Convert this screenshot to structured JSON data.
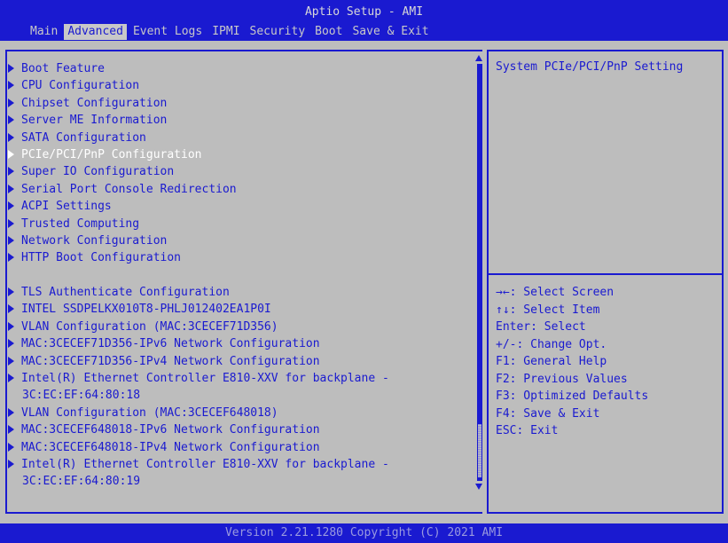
{
  "window": {
    "title": "Aptio Setup - AMI"
  },
  "tabs": [
    {
      "label": "Main",
      "active": false
    },
    {
      "label": "Advanced",
      "active": true
    },
    {
      "label": "Event Logs",
      "active": false
    },
    {
      "label": "IPMI",
      "active": false
    },
    {
      "label": "Security",
      "active": false
    },
    {
      "label": "Boot",
      "active": false
    },
    {
      "label": "Save & Exit",
      "active": false
    }
  ],
  "menu_items": [
    {
      "label": "Boot Feature"
    },
    {
      "label": "CPU Configuration"
    },
    {
      "label": "Chipset Configuration"
    },
    {
      "label": "Server ME Information"
    },
    {
      "label": "SATA Configuration"
    },
    {
      "label": "PCIe/PCI/PnP Configuration",
      "selected": true
    },
    {
      "label": "Super IO Configuration"
    },
    {
      "label": "Serial Port Console Redirection"
    },
    {
      "label": "ACPI Settings"
    },
    {
      "label": "Trusted Computing"
    },
    {
      "label": "Network Configuration"
    },
    {
      "label": "HTTP Boot Configuration"
    },
    {
      "label": "TLS Authenticate Configuration"
    },
    {
      "label": "INTEL SSDPELKX010T8-PHLJ012402EA1P0I"
    },
    {
      "label": "VLAN Configuration (MAC:3CECEF71D356)"
    },
    {
      "label": "MAC:3CECEF71D356-IPv6 Network Configuration"
    },
    {
      "label": "MAC:3CECEF71D356-IPv4 Network Configuration"
    },
    {
      "label": "Intel(R) Ethernet Controller E810-XXV for backplane -",
      "continuation": "3C:EC:EF:64:80:18"
    },
    {
      "label": "VLAN Configuration (MAC:3CECEF648018)"
    },
    {
      "label": "MAC:3CECEF648018-IPv6 Network Configuration"
    },
    {
      "label": "MAC:3CECEF648018-IPv4 Network Configuration"
    },
    {
      "label": "Intel(R) Ethernet Controller E810-XXV for backplane -",
      "continuation": "3C:EC:EF:64:80:19"
    }
  ],
  "help": {
    "description": "System PCIe/PCI/PnP Setting"
  },
  "keys": [
    "→←: Select Screen",
    "↑↓: Select Item",
    "Enter: Select",
    "+/-: Change Opt.",
    "F1: General Help",
    "F2: Previous Values",
    "F3: Optimized Defaults",
    "F4: Save & Exit",
    "ESC: Exit"
  ],
  "footer": {
    "version": "Version 2.21.1280 Copyright (C) 2021 AMI"
  },
  "colors": {
    "bios_blue": "#1a1ad0",
    "background_gray": "#bdbdbd",
    "selected_text": "#ffffff"
  }
}
